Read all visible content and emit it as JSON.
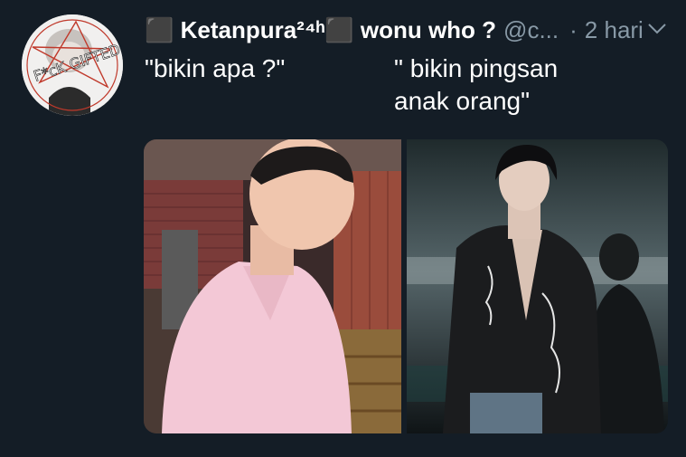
{
  "tweet": {
    "display_name": "⬛ Ketanpura²⁴ʰ⬛ wonu who ?",
    "handle": "@c...",
    "separator": "·",
    "timestamp": "2 hari",
    "text_left": "\"bikin apa ?\"",
    "text_right": "\" bikin pingsan\nanak orang\"",
    "avatar_text": "F*cK GIFTED"
  },
  "colors": {
    "background": "#141d26",
    "text": "#ffffff",
    "muted": "#8899a6"
  }
}
